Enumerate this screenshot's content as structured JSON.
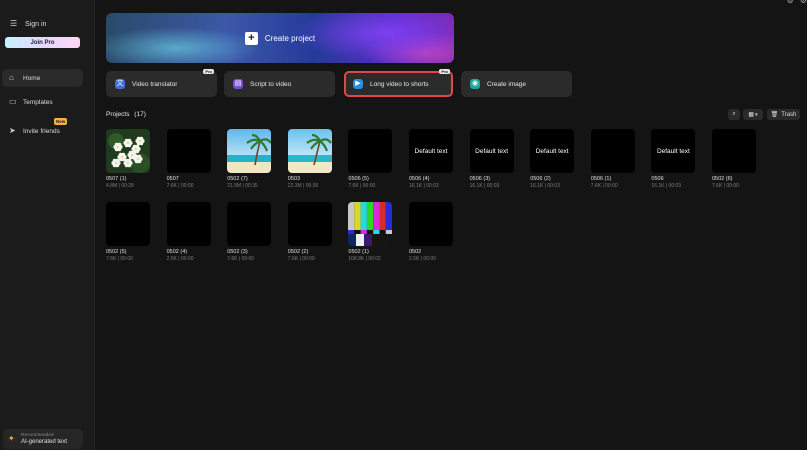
{
  "sidebar": {
    "signin_label": "Sign in",
    "joinpro_label": "Join Pro",
    "nav": [
      {
        "label": "Home",
        "icon": "home-icon"
      },
      {
        "label": "Templates",
        "icon": "templates-icon"
      },
      {
        "label": "Invite friends",
        "icon": "send-icon",
        "badge": "New"
      }
    ],
    "recommended": {
      "caption": "Recommended",
      "label": "AI-generated text"
    }
  },
  "hero": {
    "label": "Create project"
  },
  "tools": [
    {
      "label": "Video translator",
      "icon": "translate-icon",
      "icon_color": "#3d6fd8",
      "badge": "Pro"
    },
    {
      "label": "Script to video",
      "icon": "script-icon",
      "icon_color": "#7a4fd8"
    },
    {
      "label": "Long video to shorts",
      "icon": "shorts-icon",
      "icon_color": "#2c8be0",
      "badge": "Pro",
      "highlighted": true
    },
    {
      "label": "Create image",
      "icon": "image-icon",
      "icon_color": "#1fa8a0"
    }
  ],
  "projects": {
    "header": "Projects",
    "count": "(17)",
    "trash_label": "Trash",
    "items": [
      {
        "name": "0507 (1)",
        "meta": "4.8M | 00:28",
        "thumb": "flowers"
      },
      {
        "name": "0507",
        "meta": "7.6K | 00:00",
        "thumb": "black"
      },
      {
        "name": "0502 (7)",
        "meta": "21.5M | 00:35",
        "thumb": "beach"
      },
      {
        "name": "0503",
        "meta": "22.3M | 00:35",
        "thumb": "beach2"
      },
      {
        "name": "0506 (5)",
        "meta": "7.6K | 00:00",
        "thumb": "black"
      },
      {
        "name": "0506 (4)",
        "meta": "16.1K | 00:03",
        "thumb": "text",
        "text": "Default text"
      },
      {
        "name": "0506 (3)",
        "meta": "16.1K | 00:03",
        "thumb": "text",
        "text": "Default text"
      },
      {
        "name": "0506 (2)",
        "meta": "16.1K | 00:03",
        "thumb": "text",
        "text": "Default text"
      },
      {
        "name": "0506 (1)",
        "meta": "7.6K | 00:00",
        "thumb": "black"
      },
      {
        "name": "0506",
        "meta": "16.1K | 00:03",
        "thumb": "text",
        "text": "Default text"
      },
      {
        "name": "0502 (6)",
        "meta": "7.6K | 00:00",
        "thumb": "black"
      },
      {
        "name": "0502 (5)",
        "meta": "7.6K | 00:00",
        "thumb": "black"
      },
      {
        "name": "0502 (4)",
        "meta": "2.5K | 00:00",
        "thumb": "black"
      },
      {
        "name": "0502 (3)",
        "meta": "7.6K | 00:00",
        "thumb": "black"
      },
      {
        "name": "0502 (2)",
        "meta": "7.6K | 00:00",
        "thumb": "black"
      },
      {
        "name": "0502 (1)",
        "meta": "108.8K | 00:02",
        "thumb": "bars"
      },
      {
        "name": "0502",
        "meta": "2.5K | 00:00",
        "thumb": "black"
      }
    ]
  },
  "colors": {
    "highlight": "#e04848",
    "pro_gradient_start": "#c8f1ff",
    "pro_gradient_end": "#ffd7f3"
  }
}
